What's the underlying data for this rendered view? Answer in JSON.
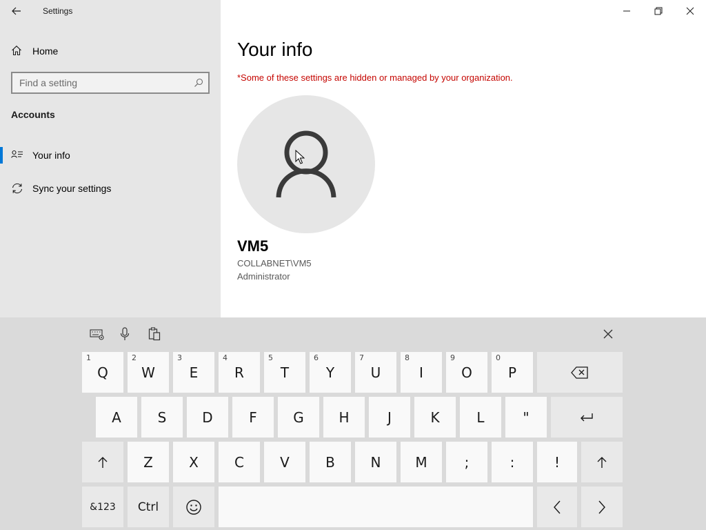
{
  "window": {
    "title": "Settings",
    "controls": {
      "minimize": "minimize-icon",
      "maximize": "restore-icon",
      "close": "close-icon"
    }
  },
  "sidebar": {
    "home_label": "Home",
    "search": {
      "placeholder": "Find a setting",
      "value": ""
    },
    "section_title": "Accounts",
    "items": [
      {
        "label": "Your info",
        "icon": "contact-card-icon",
        "selected": true
      },
      {
        "label": "Sync your settings",
        "icon": "sync-icon",
        "selected": false
      }
    ]
  },
  "main": {
    "heading": "Your info",
    "notice": "*Some of these settings are hidden or managed by your organization.",
    "user": {
      "name": "VM5",
      "domain": "COLLABNET\\VM5",
      "role": "Administrator"
    }
  },
  "keyboard": {
    "toolbar": [
      "keyboard-settings-icon",
      "microphone-icon",
      "clipboard-icon"
    ],
    "row1": [
      {
        "label": "Q",
        "num": "1"
      },
      {
        "label": "W",
        "num": "2"
      },
      {
        "label": "E",
        "num": "3"
      },
      {
        "label": "R",
        "num": "4"
      },
      {
        "label": "T",
        "num": "5"
      },
      {
        "label": "Y",
        "num": "6"
      },
      {
        "label": "U",
        "num": "7"
      },
      {
        "label": "I",
        "num": "8"
      },
      {
        "label": "O",
        "num": "9"
      },
      {
        "label": "P",
        "num": "0"
      }
    ],
    "row2": [
      "A",
      "S",
      "D",
      "F",
      "G",
      "H",
      "J",
      "K",
      "L",
      "\""
    ],
    "row3": [
      "Z",
      "X",
      "C",
      "V",
      "B",
      "N",
      "M",
      ";",
      ":",
      "!"
    ],
    "symbols_label": "&123",
    "ctrl_label": "Ctrl"
  },
  "colors": {
    "accent": "#0078d7",
    "notice": "#c50500",
    "sidebar_bg": "#e6e6e6",
    "keyboard_bg": "#dadada",
    "key_bg": "#f9f9f9"
  }
}
